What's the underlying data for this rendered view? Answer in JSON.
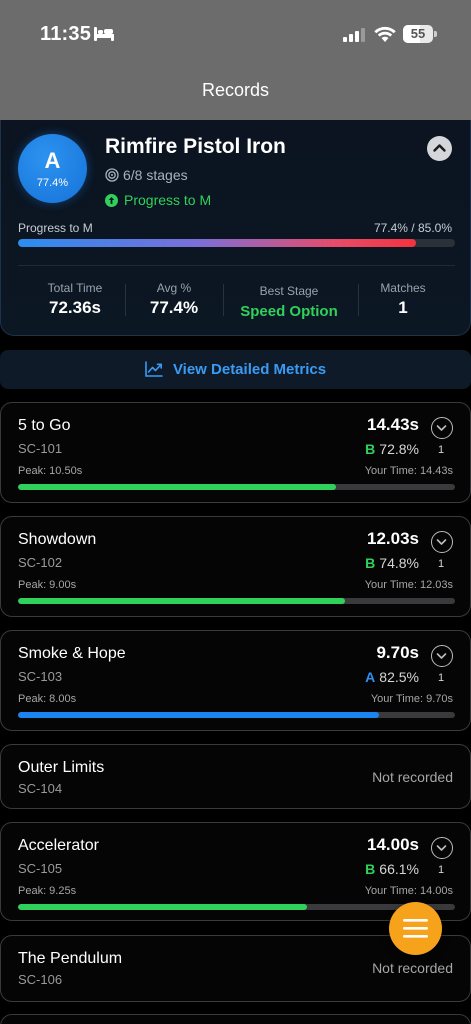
{
  "status_bar": {
    "time": "11:35",
    "battery": "55"
  },
  "nav": {
    "title": "Records"
  },
  "summary": {
    "grade_letter": "A",
    "grade_pct": "77.4%",
    "class_name": "Rimfire Pistol Iron",
    "stages": "6/8 stages",
    "progress_to": "Progress to M",
    "progress_label": "Progress to M",
    "progress_value": "77.4% / 85.0%",
    "progress_fraction": 0.91,
    "stats": {
      "total_time_label": "Total Time",
      "total_time": "72.36s",
      "avg_label": "Avg %",
      "avg": "77.4%",
      "best_stage_label": "Best Stage",
      "best_stage": "Speed Option",
      "matches_label": "Matches",
      "matches": "1"
    }
  },
  "metrics_button": {
    "label": "View Detailed Metrics"
  },
  "stages": [
    {
      "name": "5 to Go",
      "code": "SC-101",
      "time": "14.43s",
      "grade": "B",
      "percent": "72.8%",
      "count": "1",
      "peak": "Peak: 10.50s",
      "your_time": "Your Time: 14.43s",
      "bar_fraction": 0.728,
      "bar_color": "#30d15a",
      "grade_color": "#30d15a"
    },
    {
      "name": "Showdown",
      "code": "SC-102",
      "time": "12.03s",
      "grade": "B",
      "percent": "74.8%",
      "count": "1",
      "peak": "Peak: 9.00s",
      "your_time": "Your Time: 12.03s",
      "bar_fraction": 0.748,
      "bar_color": "#30d15a",
      "grade_color": "#30d15a"
    },
    {
      "name": "Smoke & Hope",
      "code": "SC-103",
      "time": "9.70s",
      "grade": "A",
      "percent": "82.5%",
      "count": "1",
      "peak": "Peak: 8.00s",
      "your_time": "Your Time: 9.70s",
      "bar_fraction": 0.825,
      "bar_color": "#1b84ef",
      "grade_color": "#2f8ff2"
    },
    {
      "name": "Outer Limits",
      "code": "SC-104",
      "status": "Not recorded"
    },
    {
      "name": "Accelerator",
      "code": "SC-105",
      "time": "14.00s",
      "grade": "B",
      "percent": "66.1%",
      "count": "1",
      "peak": "Peak: 9.25s",
      "your_time": "Your Time: 14.00s",
      "bar_fraction": 0.661,
      "bar_color": "#30d15a",
      "grade_color": "#30d15a"
    },
    {
      "name": "The Pendulum",
      "code": "SC-106",
      "status": "Not recorded"
    }
  ]
}
